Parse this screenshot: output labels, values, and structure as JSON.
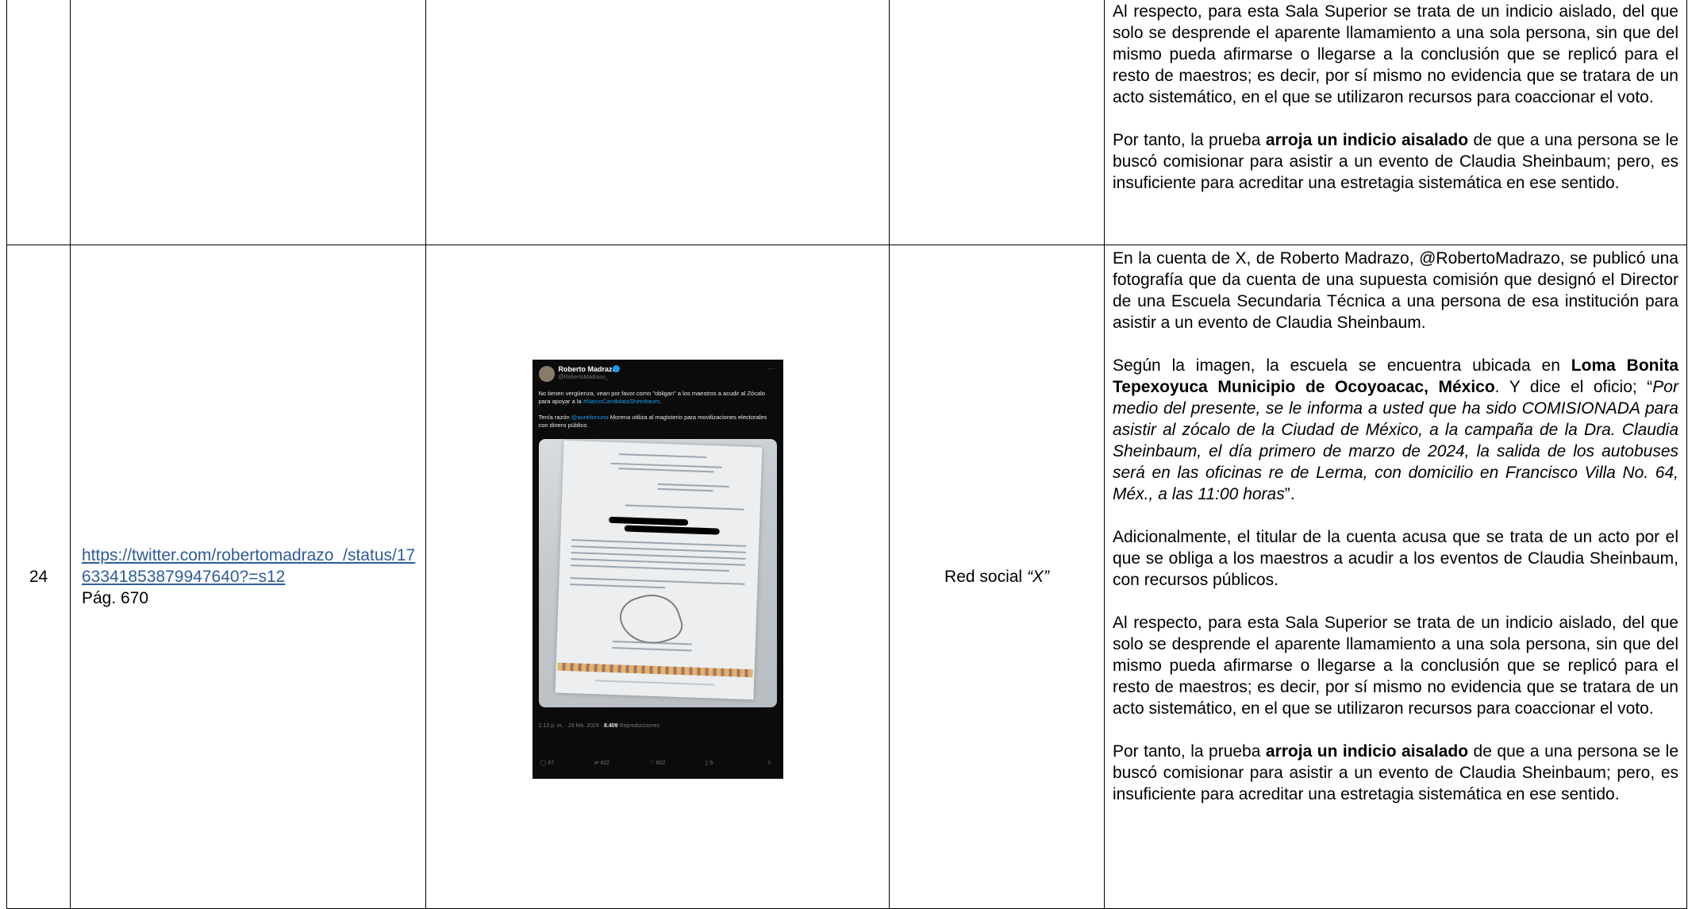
{
  "row_prev": {
    "number": "",
    "link": "",
    "medio": "",
    "analysis_p1": "Al respecto, para esta Sala Superior se trata de un indicio aislado, del que solo se desprende el aparente llamamiento a una sola persona, sin que del mismo pueda afirmarse o llegarse a la conclusión que se replicó para el resto de maestros; es decir, por sí mismo no evidencia que se tratara de un acto sistemático, en el que se utilizaron recursos para coaccionar el voto.",
    "analysis_p2_before": "Por tanto, la prueba ",
    "analysis_p2_bold": "arroja un indicio aisalado",
    "analysis_p2_after": " de que a una persona se le buscó comisionar para asistir a un evento de Claudia Sheinbaum; pero, es insuficiente para acreditar una estretagia sistemática en ese sentido."
  },
  "row_24": {
    "number": "24",
    "link_text": "https://twitter.com/robertomadrazo_/status/1763341853879947640?=s12",
    "page_ref": "Pág. 670",
    "medio_prefix": "Red social ",
    "medio_italic": "“X”",
    "p1": "En la cuenta de X, de Roberto Madrazo, @RobertoMadrazo, se publicó una fotografía que da cuenta de una supuesta comisión que designó el Director de una Escuela Secundaria Técnica a una persona de esa institución para asistir a un evento de Claudia Sheinbaum.",
    "p2_before": "Según la imagen, la escuela se encuentra ubicada en ",
    "p2_bold": "Loma Bonita Tepexoyuca Municipio de Ocoyoacac, México",
    "p2_mid": ". Y dice el oficio; “",
    "p2_italic": "Por medio del presente, se le informa a usted que ha sido COMISIONADA para asistir al zócalo de la Ciudad de México, a la campaña de la Dra. Claudia Sheinbaum, el día primero de marzo de 2024, la salida de los autobuses será en las oficinas re de Lerma, con domicilio en Francisco Villa No. 64, Méx., a las 11:00 horas",
    "p2_end": "”.",
    "p3": "Adicionalmente, el titular de la cuenta acusa que se trata de un acto por el que se obliga a los maestros a acudir a los eventos de Claudia Sheinbaum, con recursos públicos.",
    "p4": "Al respecto, para esta Sala Superior se trata de un indicio aislado, del que solo se desprende el aparente llamamiento a una sola persona, sin que del mismo pueda afirmarse o llegarse a la conclusión que se replicó para el resto de maestros; es decir, por sí mismo no evidencia que se tratara de un acto sistemático, en el que se utilizaron recursos para coaccionar el voto.",
    "p5_before": "Por tanto, la prueba ",
    "p5_bold": "arroja un indicio aisalado",
    "p5_after": " de que a una persona se le buscó comisionar para asistir a un evento de Claudia Sheinbaum; pero, es insuficiente para acreditar una estretagia sistemática en ese sentido."
  },
  "tweet": {
    "author": "Roberto Madrazo",
    "handle": "@RobertoMadrazo_",
    "more": "···",
    "text_a": "No tienen vergüenza, vean por favor como \"obligan\" a los maestros a acudir al Zócalo para apoyar a la ",
    "hashtag": "#NarcoCandidataSheinbaum",
    "text_b": ".",
    "text_c_before": "Tenía razón ",
    "mention": "@aurelionuno",
    "text_c_after": " Morena utiliza al magisterio para movilizaciones electorales con dinero público.",
    "time": "2:13 p. m. · 29 feb. 2024 · ",
    "views": "8.409",
    "views_label": " Reproducciones",
    "replies": "47",
    "reposts": "422",
    "likes": "602",
    "bookmarks": "5"
  },
  "colors": {
    "link": "#2e5c9a",
    "tweet_bg": "#0b0b0b",
    "hashtag": "#1d9bf0"
  }
}
